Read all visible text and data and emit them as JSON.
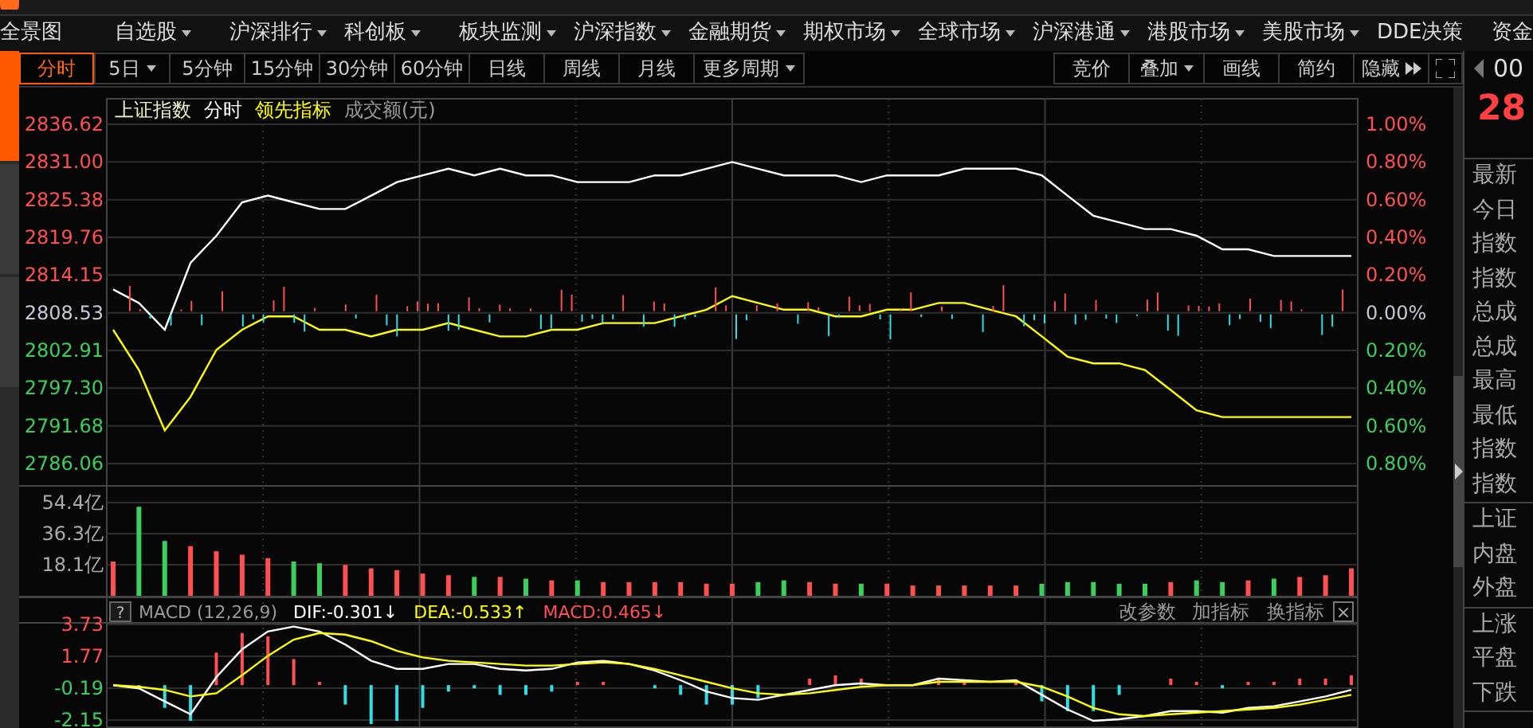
{
  "menu": [
    {
      "label": "全景图",
      "dropdown": false
    },
    {
      "label": "自选股",
      "dropdown": true
    },
    {
      "label": "沪深排行",
      "dropdown": true
    },
    {
      "label": "科创板",
      "dropdown": true
    },
    {
      "label": "板块监测",
      "dropdown": true
    },
    {
      "label": "沪深指数",
      "dropdown": true
    },
    {
      "label": "金融期货",
      "dropdown": true
    },
    {
      "label": "期权市场",
      "dropdown": true
    },
    {
      "label": "全球市场",
      "dropdown": true
    },
    {
      "label": "沪深港通",
      "dropdown": true
    },
    {
      "label": "港股市场",
      "dropdown": true
    },
    {
      "label": "美股市场",
      "dropdown": true
    },
    {
      "label": "DDE决策",
      "dropdown": false
    },
    {
      "label": "资金"
    }
  ],
  "side_tabs": [
    {
      "selected": true
    },
    {
      "selected": false
    },
    {
      "selected": false
    }
  ],
  "periods": [
    {
      "label": "分时",
      "selected": true,
      "dropdown": false
    },
    {
      "label": "5日",
      "selected": false,
      "dropdown": true
    },
    {
      "label": "5分钟",
      "selected": false,
      "dropdown": false
    },
    {
      "label": "15分钟",
      "selected": false,
      "dropdown": false
    },
    {
      "label": "30分钟",
      "selected": false,
      "dropdown": false
    },
    {
      "label": "60分钟",
      "selected": false,
      "dropdown": false
    },
    {
      "label": "日线",
      "selected": false,
      "dropdown": false
    },
    {
      "label": "周线",
      "selected": false,
      "dropdown": false
    },
    {
      "label": "月线",
      "selected": false,
      "dropdown": false
    },
    {
      "label": "更多周期",
      "selected": false,
      "dropdown": true
    }
  ],
  "tools": [
    {
      "label": "竞价",
      "dropdown": false,
      "kind": "text"
    },
    {
      "label": "叠加",
      "dropdown": true,
      "kind": "text"
    },
    {
      "label": "画线",
      "dropdown": false,
      "kind": "text"
    },
    {
      "label": "简约",
      "dropdown": false,
      "kind": "text"
    },
    {
      "label": "隐藏",
      "kind": "hide"
    },
    {
      "kind": "fullscreen"
    }
  ],
  "price_panel": {
    "legend": [
      {
        "label": "上证指数",
        "kind": "name"
      },
      {
        "label": "分时",
        "kind": "period"
      },
      {
        "label": "领先指标",
        "kind": "lead"
      },
      {
        "label": "成交额(元)",
        "kind": "unit"
      }
    ],
    "right_axis": [
      {
        "label": "1.00%",
        "color": "#ff5050"
      },
      {
        "label": "0.80%",
        "color": "#ff5050"
      },
      {
        "label": "0.60%",
        "color": "#ff5050"
      },
      {
        "label": "0.40%",
        "color": "#ff5050"
      },
      {
        "label": "0.20%",
        "color": "#ff5050"
      },
      {
        "label": "0.00%",
        "color": "#c8c8d8"
      },
      {
        "label": "0.20%",
        "color": "#3ccf5c"
      },
      {
        "label": "0.40%",
        "color": "#3ccf5c"
      },
      {
        "label": "0.60%",
        "color": "#3ccf5c"
      },
      {
        "label": "0.80%",
        "color": "#3ccf5c"
      }
    ],
    "chart_data": {
      "type": "line",
      "ylim": [
        2782.74,
        2840.42
      ],
      "grid": true,
      "yticks": [
        {
          "value": 2836.62,
          "label": "2836.62"
        },
        {
          "value": 2831.0,
          "label": "2831.00"
        },
        {
          "value": 2825.38,
          "label": "2825.38"
        },
        {
          "value": 2819.76,
          "label": "2819.76"
        },
        {
          "value": 2814.15,
          "label": "2814.15"
        },
        {
          "value": 2808.53,
          "label": "2808.53"
        },
        {
          "value": 2802.91,
          "label": "2802.91"
        },
        {
          "value": 2797.3,
          "label": "2797.30"
        },
        {
          "value": 2791.68,
          "label": "2791.68"
        },
        {
          "value": 2786.06,
          "label": "2786.06"
        }
      ],
      "series": [
        {
          "color": "#ffffff",
          "values": [
            2812,
            2810,
            2806,
            2816,
            2820,
            2825,
            2826,
            2825,
            2824,
            2824,
            2826,
            2828,
            2829,
            2830,
            2829,
            2830,
            2829,
            2829,
            2828,
            2828,
            2828,
            2829,
            2829,
            2830,
            2831,
            2830,
            2829,
            2829,
            2829,
            2828,
            2829,
            2829,
            2829,
            2830,
            2830,
            2830,
            2829,
            2826,
            2823,
            2822,
            2821,
            2821,
            2820,
            2818,
            2818,
            2817,
            2817,
            2817,
            2817
          ]
        },
        {
          "color": "#ffff00",
          "values": [
            2806,
            2800,
            2791,
            2796,
            2803,
            2806,
            2808,
            2808,
            2806,
            2806,
            2805,
            2806,
            2806,
            2807,
            2806,
            2805,
            2805,
            2806,
            2806,
            2807,
            2807,
            2807,
            2808,
            2809,
            2811,
            2810,
            2809,
            2809,
            2808,
            2808,
            2809,
            2809,
            2810,
            2810,
            2809,
            2808,
            2805,
            2802,
            2801,
            2801,
            2800,
            2797,
            2794,
            2793,
            2793,
            2793,
            2793,
            2793,
            2793
          ]
        }
      ]
    }
  },
  "volume_panel": {
    "chart_data": {
      "type": "bar",
      "ylim": [
        0,
        64.2
      ],
      "grid": true,
      "yticks": [
        {
          "value": 18.1,
          "label": "18.1亿"
        },
        {
          "value": 36.3,
          "label": "36.3亿"
        },
        {
          "value": 54.4,
          "label": "54.4亿"
        }
      ],
      "values": [
        20,
        52,
        32,
        29,
        26,
        24,
        22,
        20,
        19,
        18,
        16,
        15,
        13,
        12,
        11,
        11,
        10,
        9,
        9,
        8,
        8,
        8,
        8,
        7,
        7,
        8,
        9,
        8,
        7,
        7,
        7,
        6,
        6,
        6,
        6,
        6,
        7,
        8,
        8,
        7,
        7,
        8,
        9,
        8,
        9,
        10,
        11,
        12,
        16
      ]
    }
  },
  "macd_panel": {
    "legend": [
      {
        "label": "MACD (12,26,9)",
        "kind": "name"
      },
      {
        "label": "DIF:-0.301↓",
        "kind": "dif"
      },
      {
        "label": "DEA:-0.533↑",
        "kind": "dea"
      },
      {
        "label": "MACD:0.465↓",
        "kind": "macd"
      }
    ],
    "help": "?",
    "actions": [
      "改参数",
      "加指标",
      "换指标"
    ],
    "close": "×",
    "chart_data": {
      "type": "line",
      "ylim": [
        -2.64,
        3.83
      ],
      "grid": true,
      "yticks": [
        {
          "value": -2.15,
          "label": "-2.15"
        },
        {
          "value": -0.19,
          "label": "-0.19"
        },
        {
          "value": 1.77,
          "label": "1.77"
        },
        {
          "value": 3.73,
          "label": "3.73"
        }
      ],
      "series": [
        {
          "color": "#ffffff",
          "values": [
            0,
            -0.2,
            -1.0,
            -1.8,
            0.5,
            2.2,
            3.3,
            3.6,
            3.3,
            2.5,
            1.5,
            1.0,
            1.0,
            1.3,
            1.3,
            1.0,
            0.9,
            1.0,
            1.4,
            1.5,
            1.3,
            0.9,
            0.3,
            -0.4,
            -0.8,
            -0.9,
            -0.6,
            -0.3,
            0,
            0.1,
            0,
            0,
            0.4,
            0.3,
            0.2,
            0.3,
            -0.6,
            -1.5,
            -2.2,
            -2.1,
            -1.9,
            -1.6,
            -1.6,
            -1.7,
            -1.4,
            -1.3,
            -1.0,
            -0.7,
            -0.3
          ]
        },
        {
          "color": "#ffff00",
          "values": [
            0,
            -0.1,
            -0.3,
            -0.7,
            -0.5,
            0.6,
            1.8,
            2.8,
            3.2,
            3.1,
            2.7,
            2.1,
            1.7,
            1.5,
            1.4,
            1.3,
            1.2,
            1.2,
            1.3,
            1.4,
            1.3,
            1.0,
            0.6,
            0.2,
            -0.2,
            -0.5,
            -0.6,
            -0.5,
            -0.3,
            -0.1,
            0,
            0,
            0.2,
            0.2,
            0.2,
            0.2,
            -0.1,
            -0.7,
            -1.4,
            -1.8,
            -1.9,
            -1.8,
            -1.7,
            -1.6,
            -1.5,
            -1.4,
            -1.2,
            -0.9,
            -0.6
          ]
        }
      ]
    }
  },
  "quote": {
    "code": "00",
    "price": "28"
  },
  "stats_groups": [
    [
      "最新",
      "今日",
      "指数",
      "指数",
      "总成",
      "总成",
      "最高",
      "最低",
      "指数",
      "指数"
    ],
    [
      "上证",
      "内盘",
      "外盘"
    ],
    [
      "上涨",
      "平盘",
      "下跌"
    ]
  ]
}
